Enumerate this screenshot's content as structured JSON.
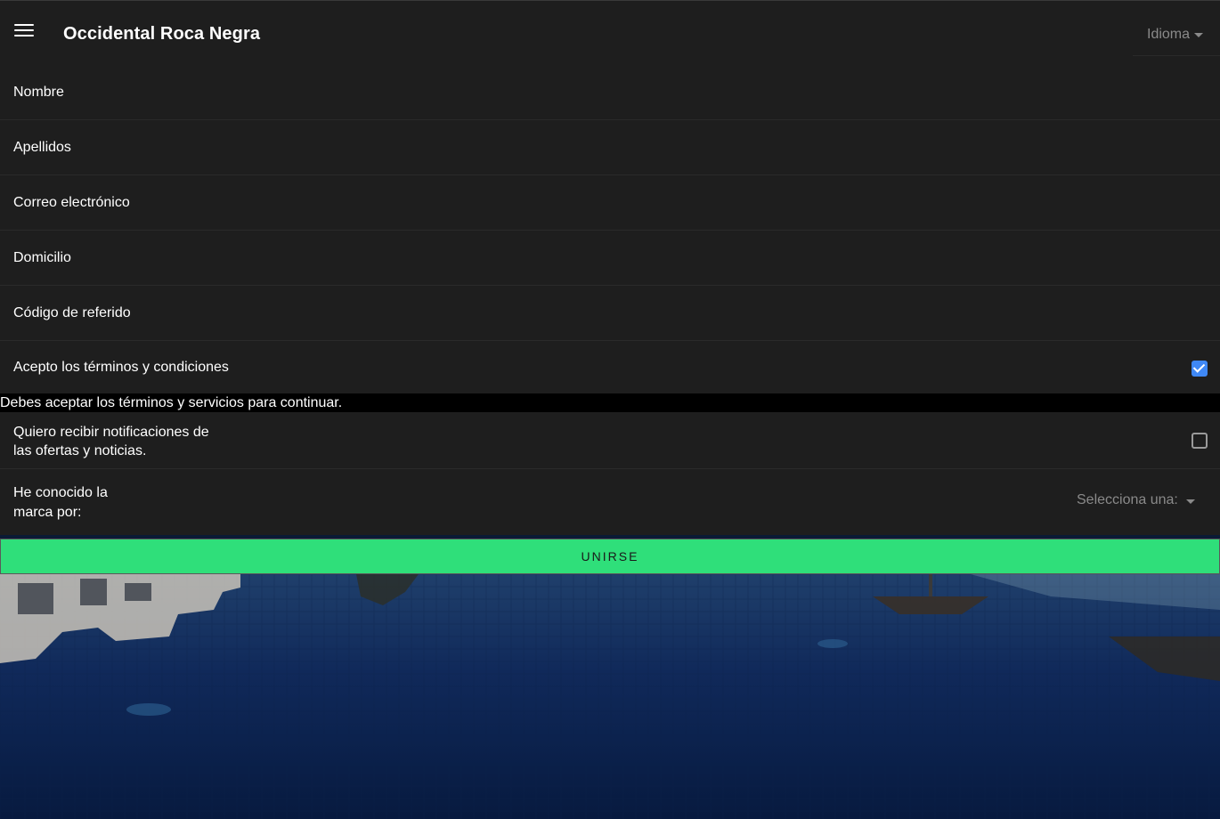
{
  "header": {
    "title": "Occidental Roca Negra",
    "language_label": "Idioma"
  },
  "form": {
    "fields": [
      {
        "placeholder": "Nombre"
      },
      {
        "placeholder": "Apellidos"
      },
      {
        "placeholder": "Correo electrónico"
      },
      {
        "placeholder": "Domicilio"
      },
      {
        "placeholder": "Código de referido"
      }
    ],
    "terms": {
      "label": "Acepto los términos y condiciones",
      "checked": true,
      "error": "Debes aceptar los términos y servicios para continuar."
    },
    "notifications": {
      "label": "Quiero recibir notificaciones de las ofertas y noticias.",
      "checked": false
    },
    "brand_source": {
      "label": "He conocido la marca por:",
      "select_value": "Selecciona una:"
    },
    "submit_label": "UNIRSE"
  },
  "colors": {
    "panel": "#1e1e1e",
    "accent_checkbox": "#3f88f5",
    "submit": "#2fdf7a",
    "muted": "#8a8a8a"
  },
  "icons": {
    "menu": "hamburger-icon",
    "caret": "caret-down-icon",
    "check": "check-icon"
  }
}
